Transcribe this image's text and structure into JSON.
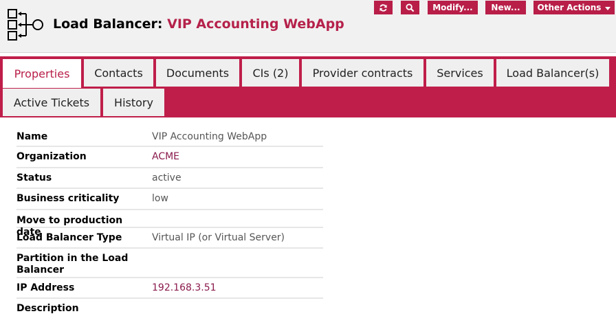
{
  "header": {
    "class_label": "Load Balancer:",
    "object_name": "VIP Accounting WebApp"
  },
  "actions": {
    "refresh_icon": "refresh-icon",
    "search_icon": "search-icon",
    "modify_label": "Modify...",
    "new_label": "New...",
    "other_actions_label": "Other Actions"
  },
  "tabs": [
    {
      "label": "Properties",
      "active": true
    },
    {
      "label": "Contacts"
    },
    {
      "label": "Documents"
    },
    {
      "label": "CIs (2)"
    },
    {
      "label": "Provider contracts"
    },
    {
      "label": "Services"
    },
    {
      "label": "Load Balancer(s)"
    },
    {
      "label": "Active Tickets"
    },
    {
      "label": "History"
    }
  ],
  "properties": [
    {
      "label": "Name",
      "value": "VIP Accounting WebApp"
    },
    {
      "label": "Organization",
      "value": "ACME"
    },
    {
      "label": "Status",
      "value": "active"
    },
    {
      "label": "Business criticality",
      "value": "low"
    },
    {
      "label": "Move to production date",
      "value": ""
    },
    {
      "label": "Load Balancer Type",
      "value": "Virtual IP (or Virtual Server)"
    },
    {
      "label": "Partition in the Load Balancer",
      "value": ""
    },
    {
      "label": "IP Address",
      "value": "192.168.3.51"
    },
    {
      "label": "Description",
      "value": ""
    }
  ],
  "colors": {
    "accent": "#bf1e4a",
    "title_name": "#b5214a",
    "link": "#8a1a4c"
  }
}
